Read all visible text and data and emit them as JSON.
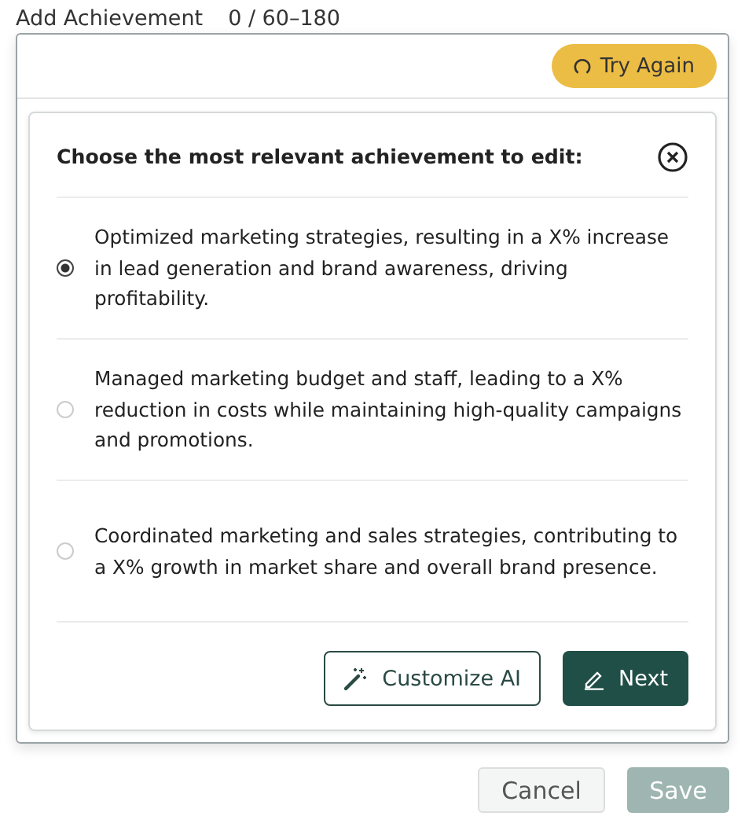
{
  "field": {
    "label": "Add Achievement",
    "counter": "0 / 60–180"
  },
  "try_again": {
    "label": "Try Again"
  },
  "dialog": {
    "title": "Choose the most relevant achievement to edit:",
    "options": [
      {
        "text": "Optimized marketing strategies, resulting in a X% increase in lead generation and brand awareness, driving profitability.",
        "selected": true
      },
      {
        "text": "Managed marketing budget and staff, leading to a X% reduction in costs while maintaining high-quality campaigns and promotions.",
        "selected": false
      },
      {
        "text": "Coordinated marketing and sales strategies, contributing to a X% growth in market share and overall brand presence.",
        "selected": false
      }
    ],
    "buttons": [
      {
        "label": "Customize AI",
        "kind": "outline"
      },
      {
        "label": "Next",
        "kind": "primary"
      }
    ]
  },
  "footer": [
    {
      "label": "Cancel",
      "disabled": false,
      "kind": "secondary"
    },
    {
      "label": "Save",
      "disabled": true,
      "kind": "primary"
    }
  ]
}
